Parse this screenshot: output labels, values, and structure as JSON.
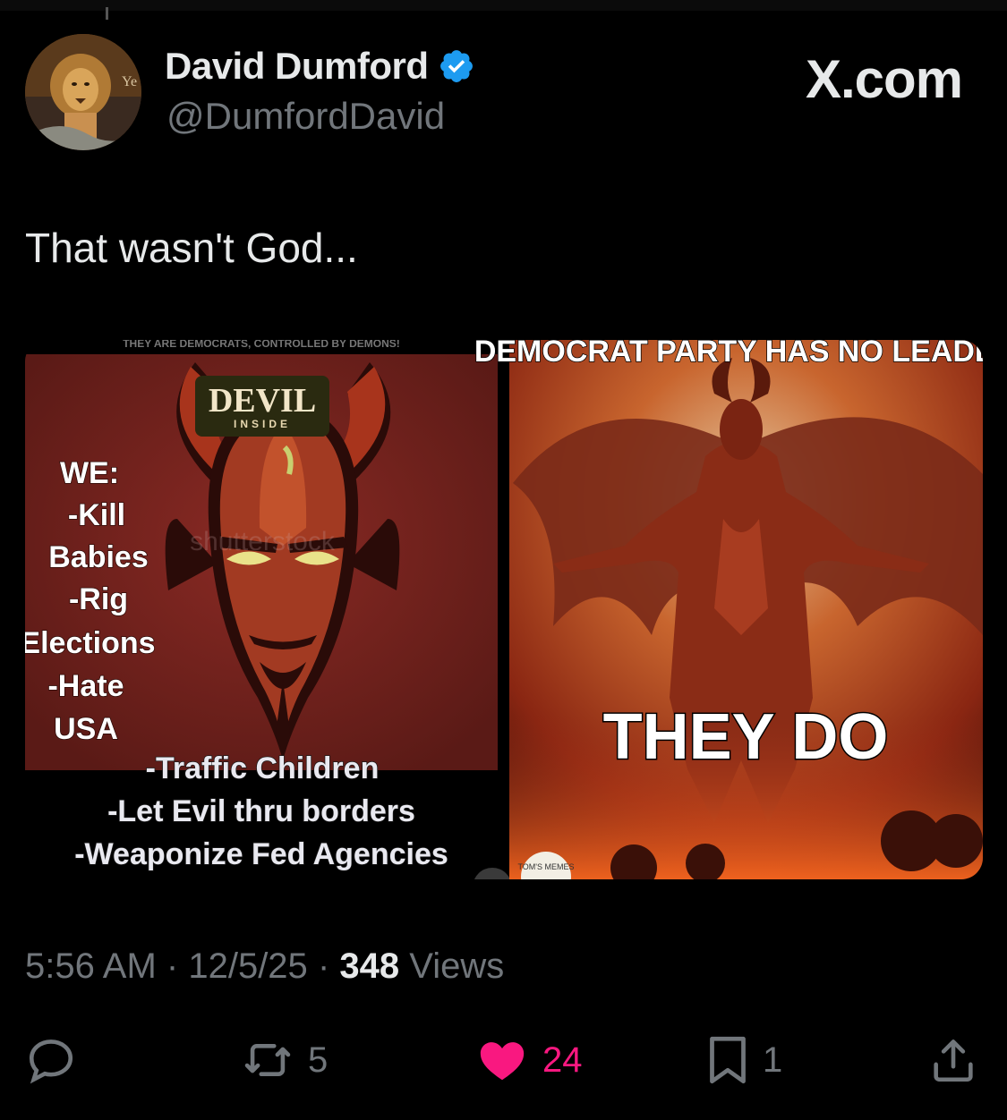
{
  "author": {
    "display_name": "David Dumford",
    "handle": "@DumfordDavid",
    "verified": true
  },
  "brand": "X.com",
  "tweet": {
    "text": "That wasn't God..."
  },
  "media": {
    "left_image": {
      "top_caption": "THEY ARE DEMOCRATS, CONTROLLED BY DEMONS!",
      "badge_title": "DEVIL",
      "badge_sub": "INSIDE",
      "watermark": "shutterstock",
      "list_lines": [
        "WE:",
        "-Kill",
        "Babies",
        "-Rig",
        "Elections",
        "-Hate",
        "USA"
      ],
      "bottom_lines": [
        "-Traffic Children",
        "-Let Evil thru borders",
        "-Weaponize Fed Agencies"
      ]
    },
    "right_image": {
      "top_caption": "DEMOCRAT PARTY HAS NO LEADER",
      "bottom_caption": "THEY DO",
      "watermark": "TOM'S MEMES"
    }
  },
  "meta": {
    "time": "5:56 AM",
    "separator": "·",
    "date": "12/5/25",
    "views_count": "348",
    "views_label": "Views"
  },
  "actions": {
    "reply_count": "",
    "retweet_count": "5",
    "like_count": "24",
    "bookmark_count": "1"
  },
  "colors": {
    "background": "#000000",
    "text_primary": "#e7e9ea",
    "text_secondary": "#71767b",
    "verified_blue": "#1d9bf0",
    "like_pink": "#f91880"
  },
  "icons": [
    "verified-badge-icon",
    "reply-icon",
    "retweet-icon",
    "heart-icon",
    "bookmark-icon",
    "share-icon",
    "expand-icon"
  ]
}
